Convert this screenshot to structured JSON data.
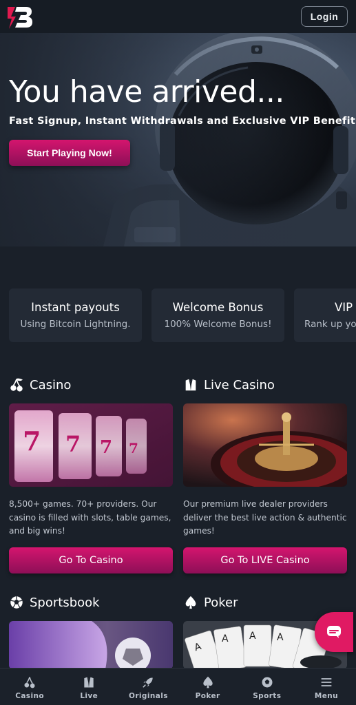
{
  "header": {
    "logo_alt": "B",
    "login_label": "Login"
  },
  "hero": {
    "title": "You have arrived...",
    "subtitle": "Fast Signup, Instant Withdrawals and Exclusive VIP Benefits!",
    "cta_label": "Start Playing Now!"
  },
  "features": [
    {
      "title": "Instant payouts",
      "desc": "Using Bitcoin Lightning."
    },
    {
      "title": "Welcome Bonus",
      "desc": "100% Welcome Bonus!"
    },
    {
      "title": "VIP L",
      "desc": "Rank up you"
    }
  ],
  "sections": {
    "casino": {
      "title": "Casino",
      "desc": "8,500+ games. 70+ providers. Our casino is filled with slots, table games, and big wins!",
      "button": "Go To Casino"
    },
    "live": {
      "title": "Live Casino",
      "desc": "Our premium live dealer providers deliver the best live action & authentic games!",
      "button": "Go To LIVE Casino"
    },
    "sportsbook": {
      "title": "Sportsbook"
    },
    "poker": {
      "title": "Poker"
    }
  },
  "bottom_nav": [
    {
      "label": "Casino",
      "icon": "cherries-icon"
    },
    {
      "label": "Live",
      "icon": "live-dealer-icon"
    },
    {
      "label": "Originals",
      "icon": "rocket-icon"
    },
    {
      "label": "Poker",
      "icon": "spade-icon"
    },
    {
      "label": "Sports",
      "icon": "soccer-ball-icon"
    },
    {
      "label": "Menu",
      "icon": "hamburger-menu-icon"
    }
  ],
  "colors": {
    "accent": "#d4156e",
    "accent_dark": "#8d0f57",
    "background": "#1a2029",
    "card": "#232a35"
  }
}
